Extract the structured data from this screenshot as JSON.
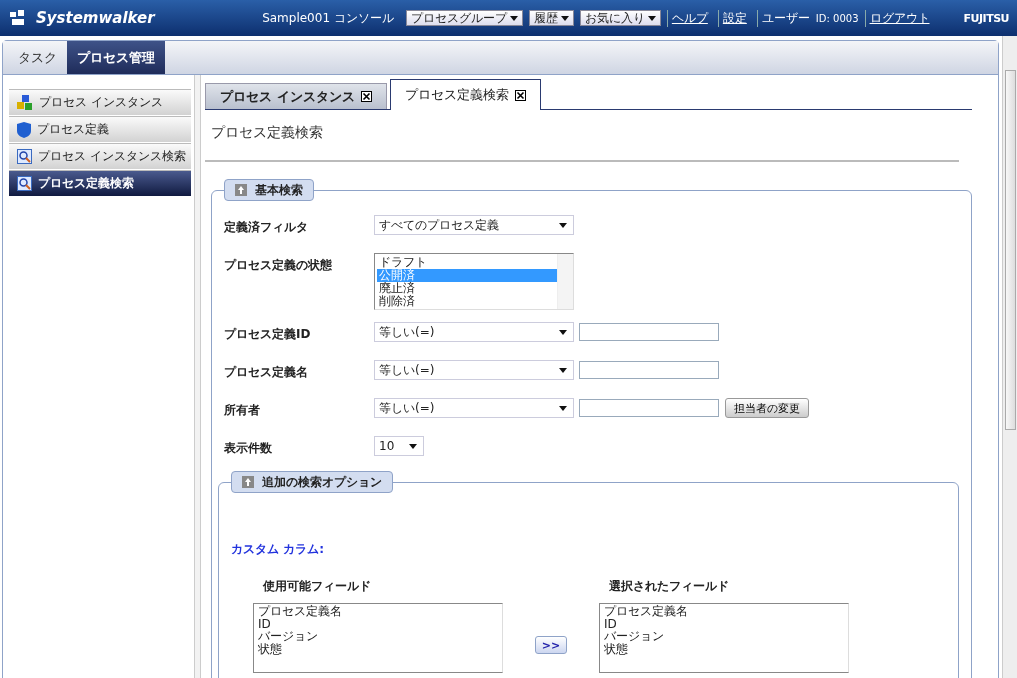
{
  "header": {
    "logo": "Systemwalker",
    "console": "Sample001 コンソール",
    "menus": [
      "プロセスグループ",
      "履歴",
      "お気に入り"
    ],
    "links": [
      "ヘルプ",
      "設定"
    ],
    "user_label": "ユーザー",
    "user_id": "ID: 0003",
    "logout": "ログアウト",
    "brand": "FUJITSU"
  },
  "main_tabs": [
    {
      "label": "タスク",
      "selected": false
    },
    {
      "label": "プロセス管理",
      "selected": true
    }
  ],
  "sidebar": {
    "items": [
      {
        "label": "プロセス インスタンス",
        "kind": "instance",
        "selected": false
      },
      {
        "label": "プロセス定義",
        "kind": "definition",
        "selected": false
      },
      {
        "label": "プロセス インスタンス検索",
        "kind": "search",
        "selected": false
      },
      {
        "label": "プロセス定義検索",
        "kind": "search",
        "selected": true
      }
    ]
  },
  "content_tabs": [
    {
      "label": "プロセス インスタンス",
      "selected": false
    },
    {
      "label": "プロセス定義検索",
      "selected": true
    }
  ],
  "page_title": "プロセス定義検索",
  "basic_search": {
    "title": "基本検索",
    "fields": [
      {
        "kind": "select",
        "label": "定義済フィルタ",
        "value": "すべてのプロセス定義"
      },
      {
        "kind": "listbox",
        "label": "プロセス定義の状態",
        "options": [
          {
            "label": "ドラフト",
            "selected": false
          },
          {
            "label": "公開済",
            "selected": true
          },
          {
            "label": "廃止済",
            "selected": false
          },
          {
            "label": "削除済",
            "selected": false
          }
        ]
      },
      {
        "kind": "condition",
        "label": "プロセス定義ID",
        "value": "等しい(=)"
      },
      {
        "kind": "condition",
        "label": "プロセス定義名",
        "value": "等しい(=)"
      },
      {
        "kind": "condition",
        "label": "所有者",
        "value": "等しい(=)",
        "button": "担当者の変更"
      },
      {
        "kind": "small",
        "label": "表示件数",
        "value": "10"
      }
    ]
  },
  "options": {
    "title": "追加の検索オプション",
    "custom_label": "カスタム カラム:",
    "available": {
      "title": "使用可能フィールド",
      "items": [
        "プロセス定義名",
        "ID",
        "バージョン",
        "状態"
      ]
    },
    "chosen": {
      "title": "選択されたフィールド",
      "items": [
        "プロセス定義名",
        "ID",
        "バージョン",
        "状態"
      ]
    },
    "move_button": ">>"
  }
}
